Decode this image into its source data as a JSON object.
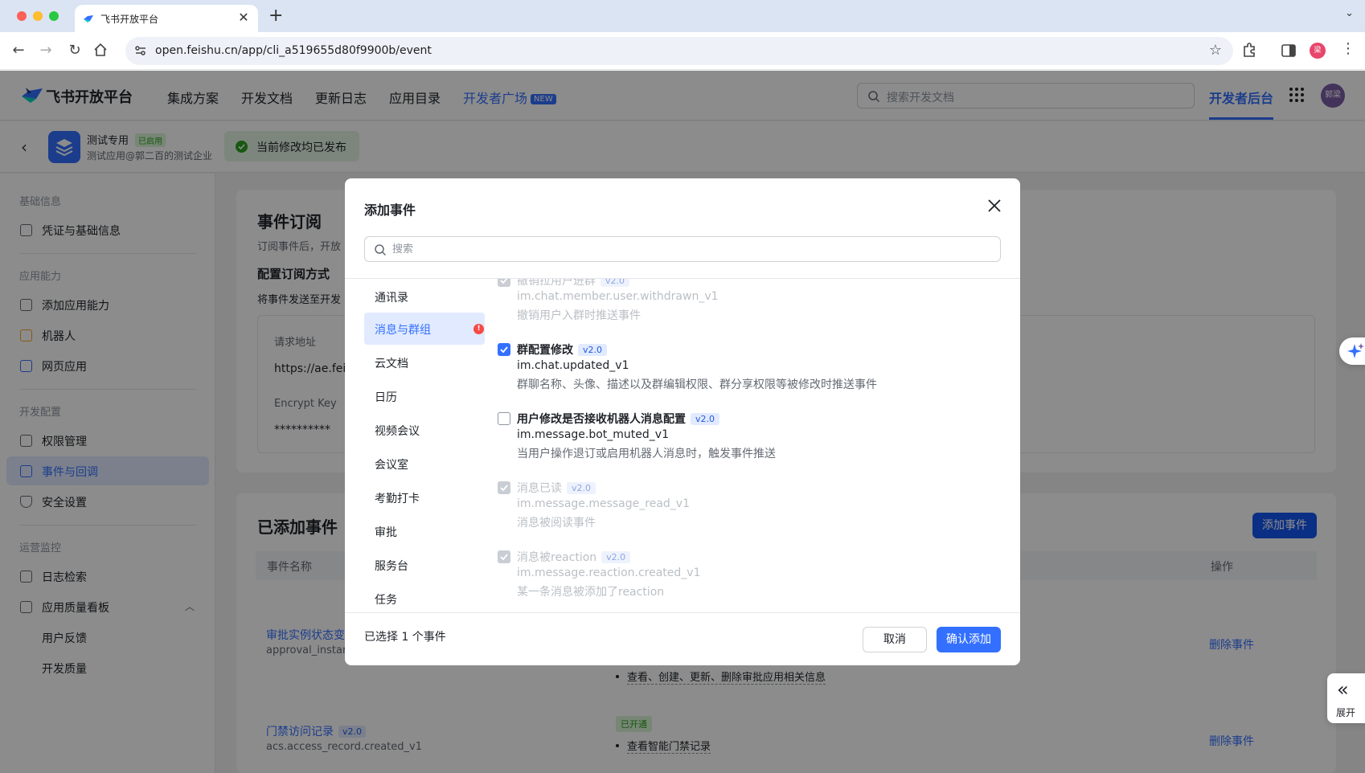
{
  "browser": {
    "tab_title": "飞书开放平台",
    "url": "open.feishu.cn/app/cli_a519655d80f9900b/event",
    "profile_initial": "梁"
  },
  "header": {
    "logo_text": "飞书开放平台",
    "nav": [
      "集成方案",
      "开发文档",
      "更新日志",
      "应用目录",
      "开发者广场"
    ],
    "new_badge": "NEW",
    "search_placeholder": "搜索开发文档",
    "dev_console": "开发者后台",
    "avatar_text": "郭梁"
  },
  "app": {
    "name": "测试专用",
    "status": "已启用",
    "subtitle": "测试应用@郭二百的测试企业",
    "publish_status": "当前修改均已发布"
  },
  "sidebar": {
    "groups": {
      "basic": "基础信息",
      "ability": "应用能力",
      "dev_config": "开发配置",
      "ops": "运营监控"
    },
    "items": {
      "credentials": "凭证与基础信息",
      "add_ability": "添加应用能力",
      "bot": "机器人",
      "web_app": "网页应用",
      "permissions": "权限管理",
      "events": "事件与回调",
      "security": "安全设置",
      "logs": "日志检索",
      "quality_board": "应用质量看板",
      "feedback": "用户反馈",
      "dev_quality": "开发质量"
    }
  },
  "main": {
    "sub_title": "事件订阅",
    "sub_desc": "订阅事件后，开放",
    "config_mode": "配置订阅方式",
    "send_to": "将事件发送至开发",
    "request_url_label": "请求地址",
    "request_url_value": "https://ae.feis",
    "encrypt_key_label": "Encrypt Key",
    "encrypt_key_value": "**********",
    "added_title": "已添加事件",
    "add_event_btn": "添加事件",
    "col_event_name": "事件名称",
    "col_action": "操作",
    "rows": [
      {
        "name": "审批实例状态变",
        "key": "approval_instan",
        "perm": "查看、创建、更新、删除审批应用相关信息",
        "action": "删除事件"
      },
      {
        "name": "门禁访问记录",
        "version": "v2.0",
        "key": "acs.access_record.created_v1",
        "badge": "已开通",
        "perm": "查看智能门禁记录",
        "action": "删除事件"
      }
    ]
  },
  "modal": {
    "title": "添加事件",
    "search_placeholder": "搜索",
    "categories": [
      "通讯录",
      "消息与群组",
      "云文档",
      "日历",
      "视频会议",
      "会议室",
      "考勤打卡",
      "审批",
      "服务台",
      "任务"
    ],
    "active_category_alert": "!",
    "events": [
      {
        "name": "撤销拉用户进群",
        "version": "v2.0",
        "key": "im.chat.member.user.withdrawn_v1",
        "desc": "撤销用户入群时推送事件",
        "state": "disabled"
      },
      {
        "name": "群配置修改",
        "version": "v2.0",
        "key": "im.chat.updated_v1",
        "desc": "群聊名称、头像、描述以及群编辑权限、群分享权限等被修改时推送事件",
        "state": "checked"
      },
      {
        "name": "用户修改是否接收机器人消息配置",
        "version": "v2.0",
        "key": "im.message.bot_muted_v1",
        "desc": "当用户操作退订或启用机器人消息时，触发事件推送",
        "state": "unchecked"
      },
      {
        "name": "消息已读",
        "version": "v2.0",
        "key": "im.message.message_read_v1",
        "desc": "消息被阅读事件",
        "state": "disabled"
      },
      {
        "name": "消息被reaction",
        "version": "v2.0",
        "key": "im.message.reaction.created_v1",
        "desc": "某一条消息被添加了reaction",
        "state": "disabled"
      }
    ],
    "selected_count": "已选择 1 个事件",
    "cancel": "取消",
    "confirm": "确认添加"
  },
  "floating": {
    "expand": "展开"
  },
  "colors": {
    "primary": "#3370ff",
    "confirm_blue": "#1456f0",
    "success": "#2ea121",
    "danger": "#f54a45"
  }
}
